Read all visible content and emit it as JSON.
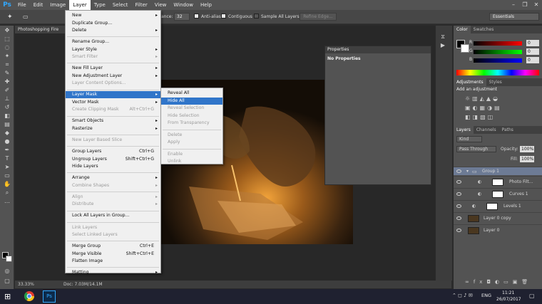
{
  "app": {
    "logo": "Ps"
  },
  "menubar": {
    "items": [
      "File",
      "Edit",
      "Image",
      "Layer",
      "Type",
      "Select",
      "Filter",
      "View",
      "Window",
      "Help"
    ],
    "active": "Layer"
  },
  "options_bar": {
    "tolerance_label": "ance:",
    "tolerance_value": "32",
    "antialias_label": "Anti-alias",
    "contiguous_label": "Contiguous",
    "sample_all_label": "Sample All Layers",
    "refine_edge_label": "Refine Edge...",
    "workspace": "Essentials"
  },
  "document": {
    "tab_title": "Photoshopping Fire",
    "zoom": "33.33%",
    "doc_size": "Doc: 7.03M/14.1M"
  },
  "properties_panel": {
    "title": "Properties",
    "body": "No Properties"
  },
  "color_panel": {
    "tabs": [
      "Color",
      "Swatches"
    ],
    "r": "0",
    "g": "0",
    "b": "0"
  },
  "adjustments_panel": {
    "tabs": [
      "Adjustments",
      "Styles"
    ],
    "heading": "Add an adjustment"
  },
  "layers_panel": {
    "tabs": [
      "Layers",
      "Channels",
      "Paths"
    ],
    "kind": "Kind",
    "blend_mode": "Pass Through",
    "opacity_label": "Opacity:",
    "opacity": "100%",
    "fill_label": "Fill:",
    "fill": "100%",
    "layers": [
      {
        "name": "Group 1"
      },
      {
        "name": "Photo Filt..."
      },
      {
        "name": "Curves 1"
      },
      {
        "name": "Levels 1"
      },
      {
        "name": "Layer 0 copy"
      },
      {
        "name": "Layer 0"
      }
    ]
  },
  "layer_menu": {
    "items": [
      {
        "label": "New",
        "submenu": true
      },
      {
        "label": "Duplicate Group..."
      },
      {
        "label": "Delete",
        "submenu": true
      },
      {
        "label": "Rename Group..."
      },
      {
        "label": "Layer Style",
        "submenu": true
      },
      {
        "label": "Smart Filter",
        "submenu": true,
        "disabled": true
      },
      {
        "label": "New Fill Layer",
        "submenu": true
      },
      {
        "label": "New Adjustment Layer",
        "submenu": true
      },
      {
        "label": "Layer Content Options...",
        "disabled": true
      },
      {
        "label": "Layer Mask",
        "submenu": true,
        "highlighted": true
      },
      {
        "label": "Vector Mask",
        "submenu": true
      },
      {
        "label": "Create Clipping Mask",
        "shortcut": "Alt+Ctrl+G",
        "disabled": true
      },
      {
        "label": "Smart Objects",
        "submenu": true
      },
      {
        "label": "Rasterize",
        "submenu": true
      },
      {
        "label": "New Layer Based Slice",
        "disabled": true
      },
      {
        "label": "Group Layers",
        "shortcut": "Ctrl+G"
      },
      {
        "label": "Ungroup Layers",
        "shortcut": "Shift+Ctrl+G"
      },
      {
        "label": "Hide Layers"
      },
      {
        "label": "Arrange",
        "submenu": true
      },
      {
        "label": "Combine Shapes",
        "submenu": true,
        "disabled": true
      },
      {
        "label": "Align",
        "submenu": true,
        "disabled": true
      },
      {
        "label": "Distribute",
        "submenu": true,
        "disabled": true
      },
      {
        "label": "Lock All Layers in Group..."
      },
      {
        "label": "Link Layers",
        "disabled": true
      },
      {
        "label": "Select Linked Layers",
        "disabled": true
      },
      {
        "label": "Merge Group",
        "shortcut": "Ctrl+E"
      },
      {
        "label": "Merge Visible",
        "shortcut": "Shift+Ctrl+E"
      },
      {
        "label": "Flatten Image"
      },
      {
        "label": "Matting",
        "submenu": true
      }
    ]
  },
  "layer_mask_submenu": {
    "items": [
      {
        "label": "Reveal All"
      },
      {
        "label": "Hide All",
        "highlighted": true
      },
      {
        "label": "Reveal Selection",
        "disabled": true
      },
      {
        "label": "Hide Selection",
        "disabled": true
      },
      {
        "label": "From Transparency",
        "disabled": true
      },
      {
        "label": "Delete",
        "disabled": true
      },
      {
        "label": "Apply",
        "disabled": true
      },
      {
        "label": "Enable",
        "disabled": true
      },
      {
        "label": "Unlink",
        "disabled": true
      }
    ]
  },
  "taskbar": {
    "language": "ENG",
    "time": "11:21",
    "date": "26/07/2017"
  }
}
